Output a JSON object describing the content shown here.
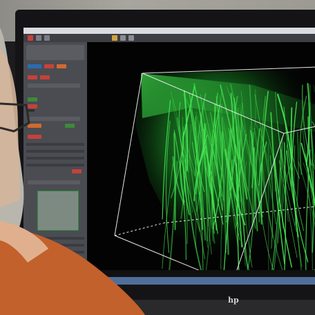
{
  "scene": {
    "description_elements": [
      "monitor",
      "microscopy-software",
      "3d-volume-render",
      "observer"
    ],
    "colors": {
      "signal_green": "#3ddc4a",
      "panel_gray": "#4a4c52",
      "jacket_orange": "#c2612c",
      "status_bar_blue": "#4f6f9a",
      "background_black": "#030303"
    }
  },
  "monitor": {
    "brand_logo": "hp"
  },
  "software": {
    "menu_text": "",
    "status_text": "",
    "histogram_panel": "green-bordered"
  },
  "render": {
    "type": "3d-volume",
    "bounding_box": "white-wireframe-cube",
    "signal": "green-filaments"
  }
}
